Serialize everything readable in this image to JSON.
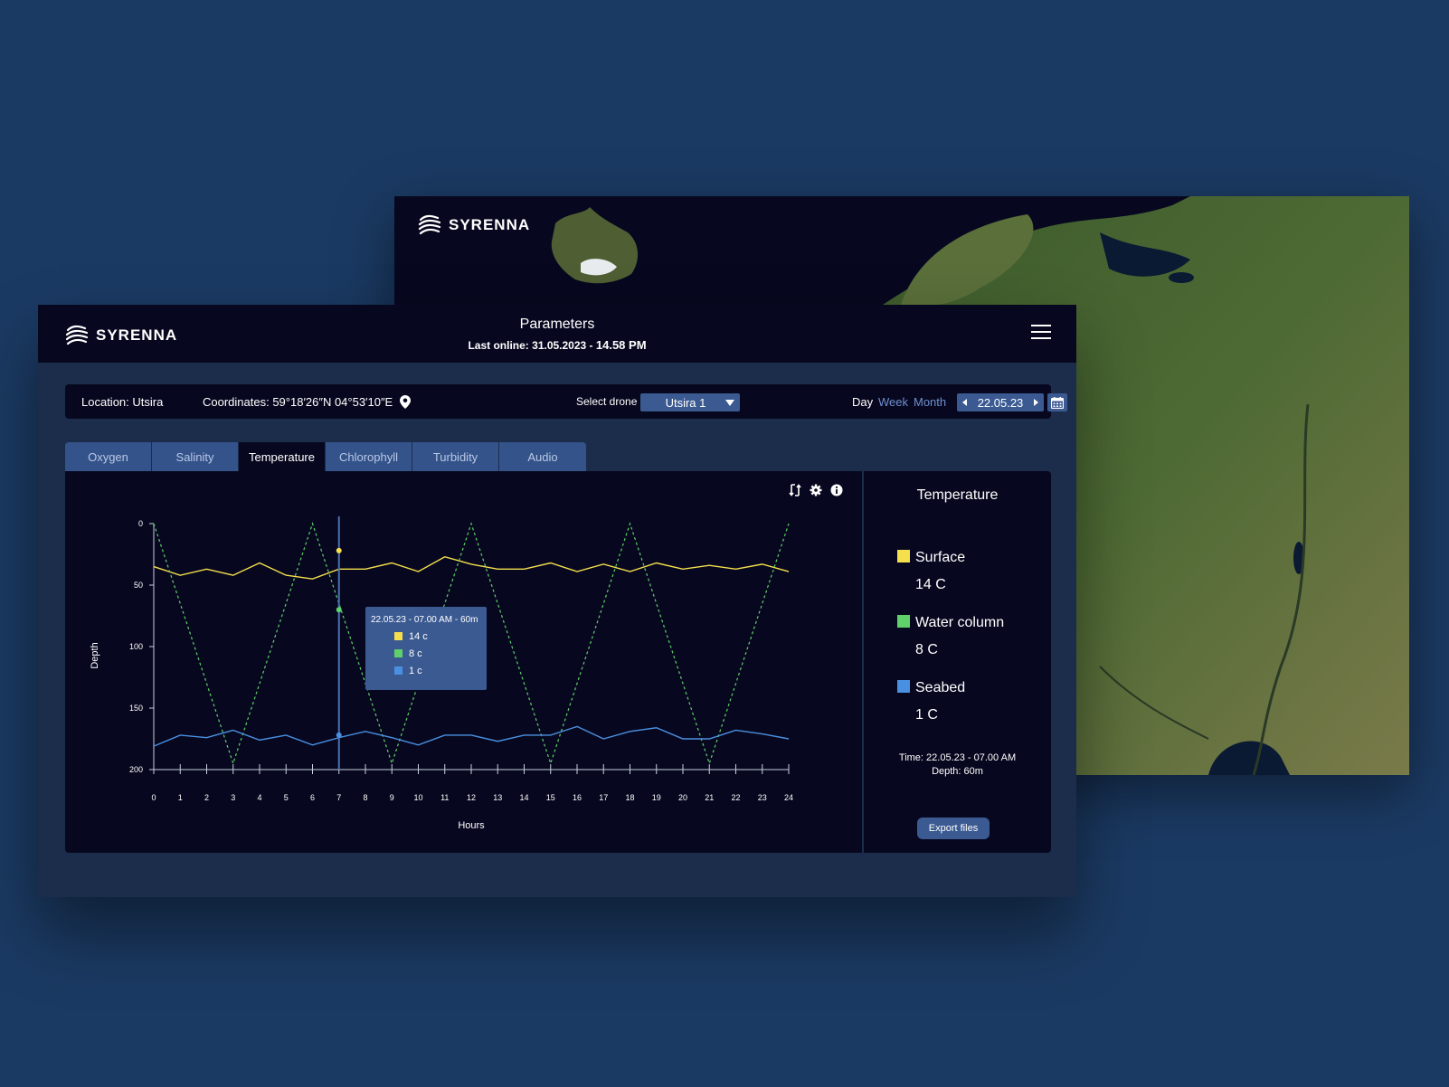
{
  "brand": {
    "name": "SYRENNA"
  },
  "header": {
    "title": "Parameters",
    "last_online_prefix": "Last online: 31.05.2023 - ",
    "last_online_time": "14.58 PM"
  },
  "filters": {
    "location": "Location: Utsira",
    "coordinates": "Coordinates: 59°18′26″N 04°53′10″E",
    "select_drone_label": "Select drone",
    "drone_value": "Utsira 1",
    "periods": [
      "Day",
      "Week",
      "Month"
    ],
    "active_period": "Day",
    "date": "22.05.23"
  },
  "tabs": [
    "Oxygen",
    "Salinity",
    "Temperature",
    "Chlorophyll",
    "Turbidity",
    "Audio"
  ],
  "active_tab": "Temperature",
  "legend": {
    "title": "Temperature",
    "items": [
      {
        "label": "Surface",
        "value": "14 C",
        "color": "#f5df4d"
      },
      {
        "label": "Water column",
        "value": "8 C",
        "color": "#5fd06a"
      },
      {
        "label": "Seabed",
        "value": "1 C",
        "color": "#4a90e2"
      }
    ],
    "time": "Time: 22.05.23 - 07.00 AM",
    "depth": "Depth: 60m",
    "export_label": "Export files"
  },
  "tooltip": {
    "title": "22.05.23 - 07.00 AM - 60m",
    "rows": [
      "14 c",
      "8 c",
      "1 c"
    ]
  },
  "icons": [
    "menu-icon",
    "location-pin-icon",
    "calendar-icon",
    "swap-icon",
    "gear-icon",
    "info-icon"
  ],
  "chart_data": {
    "type": "line",
    "xlabel": "Hours",
    "ylabel": "Depth",
    "x": [
      0,
      1,
      2,
      3,
      4,
      5,
      6,
      7,
      8,
      9,
      10,
      11,
      12,
      13,
      14,
      15,
      16,
      17,
      18,
      19,
      20,
      21,
      22,
      23,
      24
    ],
    "xlim": [
      0,
      24
    ],
    "ylim": [
      0,
      200
    ],
    "y_inverted": true,
    "y_ticks": [
      0,
      50,
      100,
      150,
      200
    ],
    "series": [
      {
        "name": "Surface",
        "color": "#f5df4d",
        "style": "solid",
        "values": [
          35,
          42,
          37,
          42,
          32,
          42,
          45,
          37,
          37,
          32,
          39,
          27,
          33,
          37,
          37,
          32,
          39,
          33,
          39,
          32,
          37,
          34,
          37,
          33,
          39
        ]
      },
      {
        "name": "Water column",
        "color": "#5fd06a",
        "style": "dashed",
        "values": [
          0,
          65,
          130,
          195,
          130,
          65,
          0,
          65,
          130,
          195,
          130,
          65,
          0,
          65,
          130,
          195,
          130,
          65,
          0,
          65,
          130,
          195,
          130,
          65,
          0
        ]
      },
      {
        "name": "Seabed",
        "color": "#4a90e2",
        "style": "solid",
        "values": [
          181,
          172,
          174,
          168,
          176,
          172,
          180,
          174,
          169,
          174,
          180,
          172,
          172,
          177,
          172,
          172,
          165,
          175,
          169,
          166,
          175,
          175,
          168,
          171,
          175
        ]
      }
    ],
    "cursor": {
      "x": 7,
      "points": [
        22,
        70,
        172
      ]
    }
  }
}
